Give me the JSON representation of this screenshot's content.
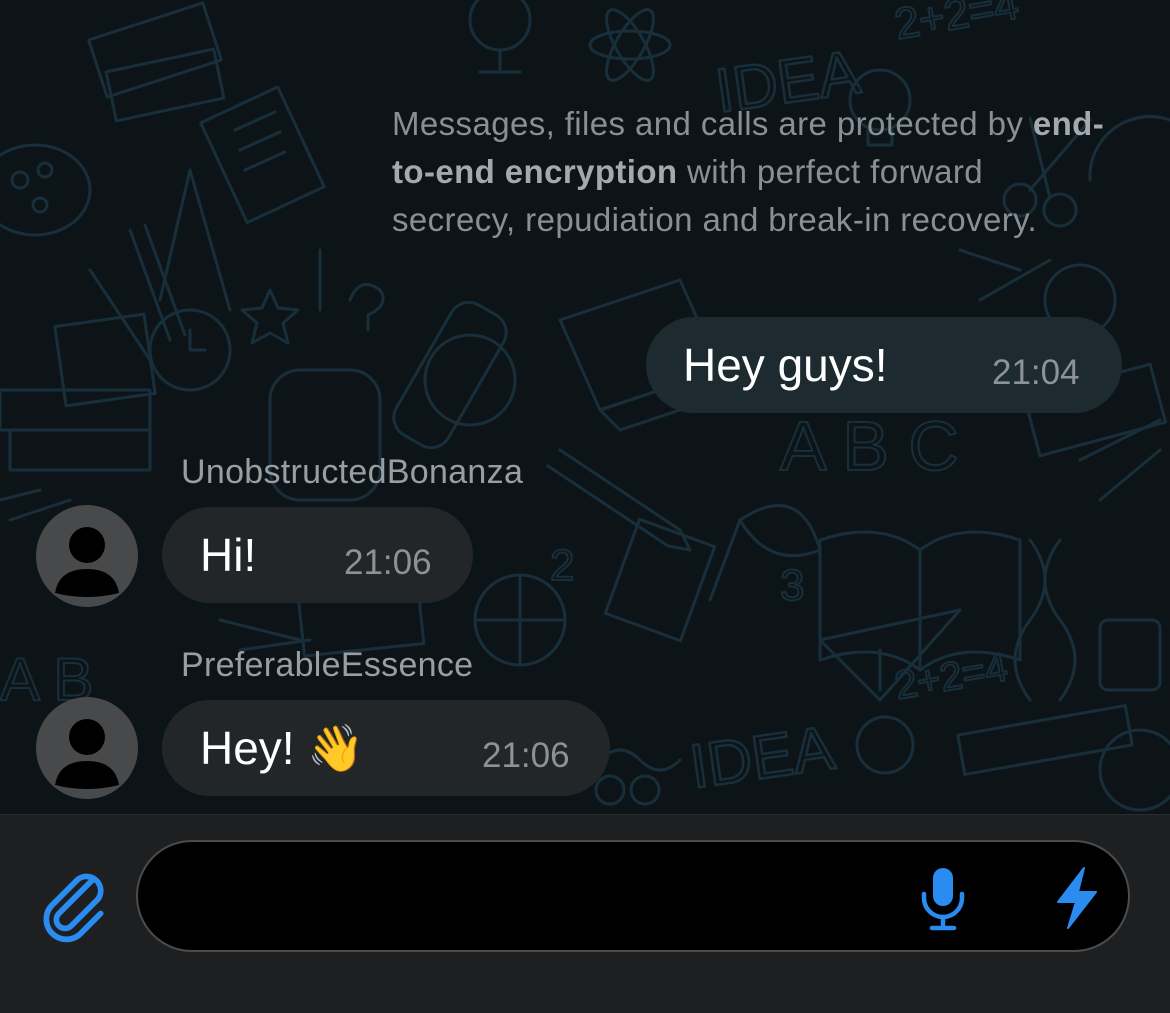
{
  "notice": {
    "text_before": "Messages, files and calls are protected by",
    "text_bold": "end-to-end encryption",
    "text_after": "with perfect forward secrecy, repudiation and break-in recovery."
  },
  "messages": [
    {
      "direction": "outgoing",
      "sender": "",
      "text": "Hey guys!",
      "time": "21:04"
    },
    {
      "direction": "incoming",
      "sender": "UnobstructedBonanza",
      "text": "Hi!",
      "time": "21:06",
      "avatar_icon": "person-silhouette-icon"
    },
    {
      "direction": "incoming",
      "sender": "PreferableEssence",
      "text": "Hey! 👋",
      "time": "21:06",
      "avatar_icon": "person-silhouette-icon"
    }
  ],
  "input_bar": {
    "placeholder": "",
    "value": "",
    "attach_icon": "paperclip-icon",
    "mic_icon": "microphone-icon",
    "bolt_icon": "lightning-bolt-icon"
  },
  "colors": {
    "accent": "#2a8cf0",
    "background": "#0d1418",
    "incoming_bubble": "#222629",
    "outgoing_bubble": "#1d2b31",
    "input_bar": "#1e1f21"
  }
}
